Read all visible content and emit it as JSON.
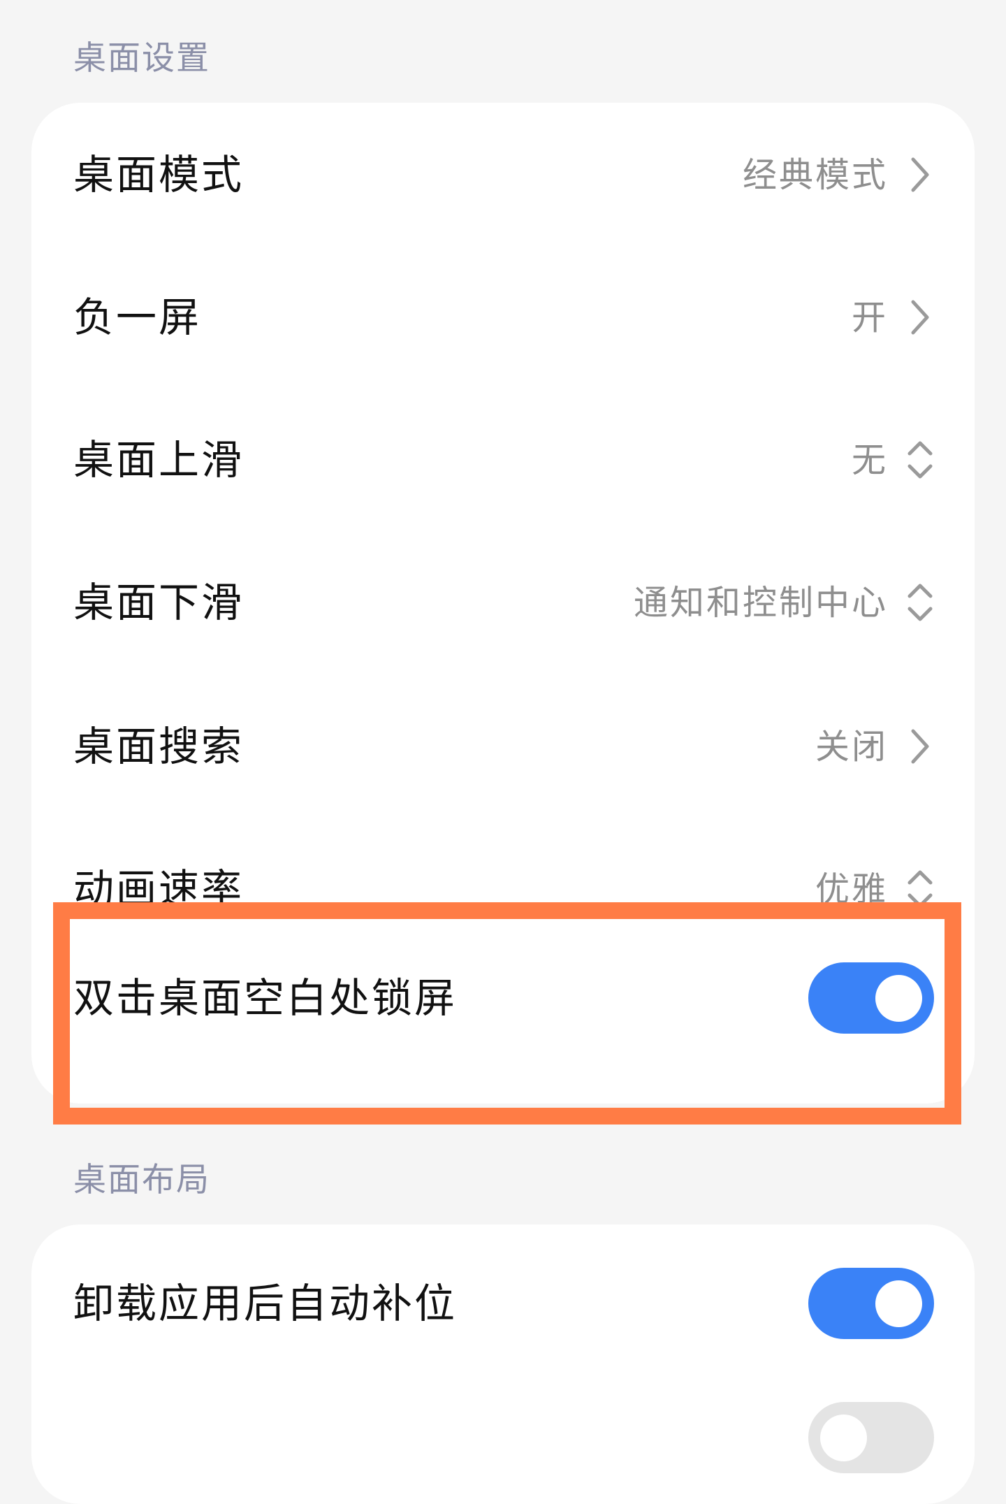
{
  "sections": {
    "desktop_settings_title": "桌面设置",
    "desktop_layout_title": "桌面布局"
  },
  "desktop_settings": {
    "desktop_mode": {
      "label": "桌面模式",
      "value": "经典模式",
      "icon": "chevron-right-icon"
    },
    "minus_one_screen": {
      "label": "负一屏",
      "value": "开",
      "icon": "chevron-right-icon"
    },
    "swipe_up": {
      "label": "桌面上滑",
      "value": "无",
      "icon": "chevron-up-down-icon"
    },
    "swipe_down": {
      "label": "桌面下滑",
      "value": "通知和控制中心",
      "icon": "chevron-up-down-icon"
    },
    "desktop_search": {
      "label": "桌面搜索",
      "value": "关闭",
      "icon": "chevron-right-icon"
    },
    "animation_speed": {
      "label": "动画速率",
      "value": "优雅",
      "icon": "chevron-up-down-icon"
    },
    "double_tap_lock": {
      "label": "双击桌面空白处锁屏",
      "enabled": true
    }
  },
  "desktop_layout": {
    "auto_fill_after_uninstall": {
      "label": "卸载应用后自动补位",
      "enabled": true
    },
    "next_item_toggle": {
      "enabled": false
    }
  },
  "colors": {
    "toggle_on": "#3a82f7",
    "toggle_off": "#e4e4e4",
    "highlight_border": "#ff7c45",
    "section_title": "#8b8fa8",
    "value_text": "#8e8e8e",
    "background": "#f5f5f5"
  }
}
